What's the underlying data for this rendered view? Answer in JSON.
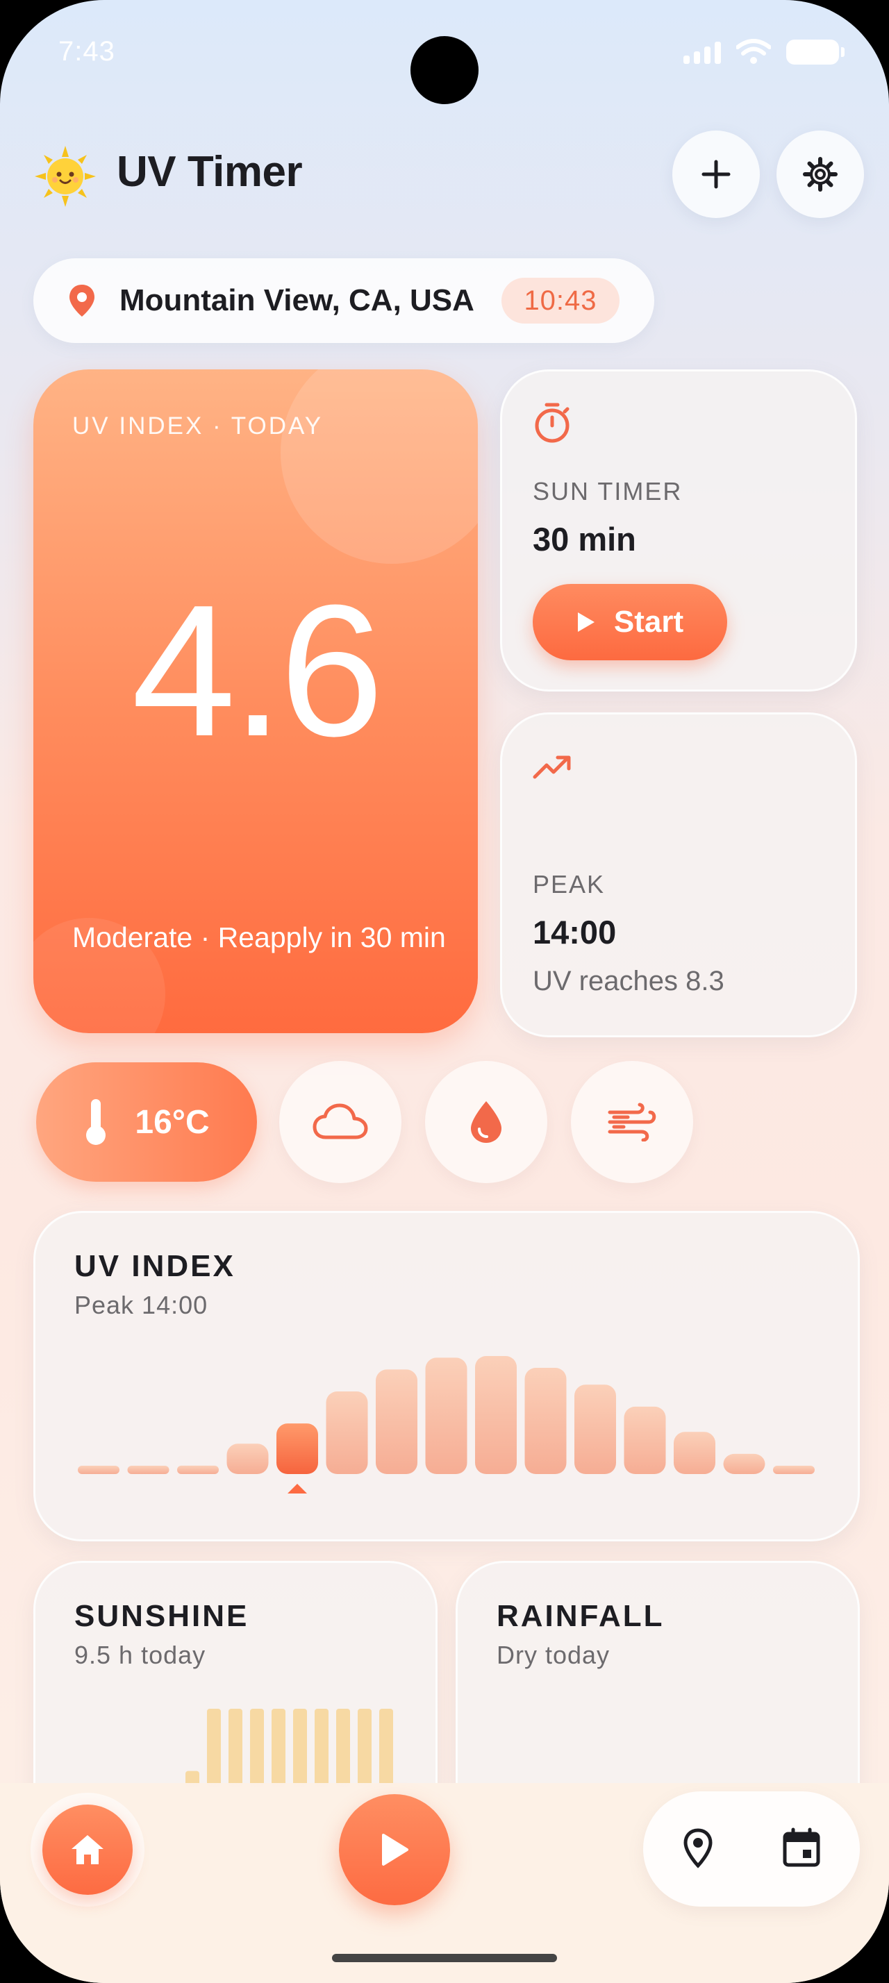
{
  "status_bar": {
    "time": "7:43"
  },
  "header": {
    "logo_icon": "sun-emoji-icon",
    "title": "UV Timer",
    "add_icon": "plus-icon",
    "settings_icon": "gear-icon"
  },
  "location": {
    "icon": "location-pin-icon",
    "name": "Mountain View, CA, USA",
    "time": "10:43"
  },
  "uv_card": {
    "label": "UV INDEX · TODAY",
    "value": "4.6",
    "subtitle": "Moderate · Reapply in 30 min"
  },
  "sun_timer": {
    "icon": "stopwatch-icon",
    "label": "SUN TIMER",
    "value": "30 min",
    "start_label": "Start"
  },
  "peak": {
    "icon": "trending-up-icon",
    "label": "PEAK",
    "value": "14:00",
    "note": "UV reaches 8.3"
  },
  "chips": {
    "temperature": "16°C",
    "icons": [
      "thermometer-icon",
      "cloud-icon",
      "water-drop-icon",
      "wind-icon"
    ]
  },
  "uv_chart": {
    "title": "UV INDEX",
    "subtitle": "Peak 14:00",
    "selected_index": 4
  },
  "chart_data": {
    "type": "bar",
    "values": [
      0.2,
      0.2,
      0.5,
      1.8,
      3.0,
      4.9,
      6.2,
      6.9,
      7.0,
      6.3,
      5.3,
      4.0,
      2.5,
      1.2,
      0.2
    ],
    "title": "UV INDEX",
    "subtitle": "Peak 14:00"
  },
  "sunshine": {
    "title": "SUNSHINE",
    "subtitle": "9.5 h today",
    "bars": [
      0.2,
      1,
      1,
      1,
      1,
      1,
      1,
      1,
      1,
      1
    ]
  },
  "rainfall": {
    "title": "RAINFALL",
    "subtitle": "Dry today"
  },
  "nav": {
    "home_icon": "home-icon",
    "play_icon": "play-icon",
    "location_icon": "location-pin-outline-icon",
    "calendar_icon": "calendar-icon"
  },
  "colors": {
    "accent": "#fd6b42",
    "accent_light": "#ffb385",
    "bar_light": "#f9c0a8",
    "sunshine_bar": "#f7d9a3"
  }
}
